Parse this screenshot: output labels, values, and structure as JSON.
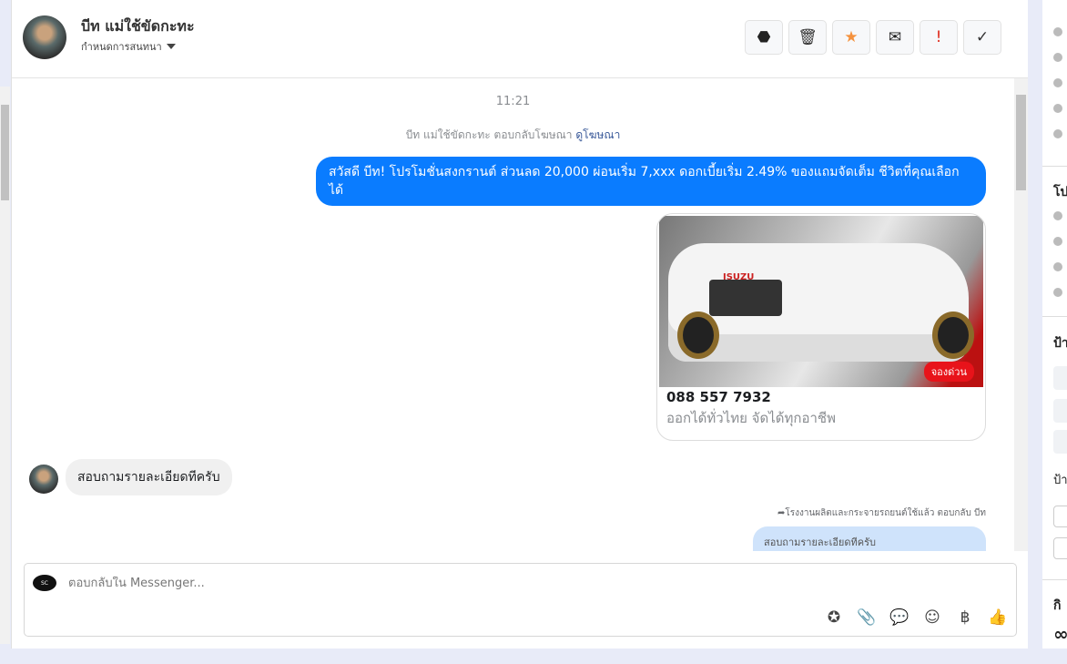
{
  "header": {
    "name": "บีท แม่ใช้ขัดกะทะ",
    "subtitle": "กำหนดการสนทนา"
  },
  "toolbar": [
    {
      "icon": "alert-octagon-icon",
      "glyph": "⬣",
      "color": "#222"
    },
    {
      "icon": "trash-icon",
      "glyph": "🗑",
      "color": "#333"
    },
    {
      "icon": "star-icon",
      "glyph": "★",
      "color": "#f5923e"
    },
    {
      "icon": "envelope-icon",
      "glyph": "✉",
      "color": "#222"
    },
    {
      "icon": "exclamation-icon",
      "glyph": "!",
      "color": "#e02a1b"
    },
    {
      "icon": "check-icon",
      "glyph": "✓",
      "color": "#333"
    }
  ],
  "chat": {
    "time": "11:21",
    "ad_note": "บีท แม่ใช้ขัดกะทะ ตอบกลับโฆษณา",
    "ad_link": "ดูโฆษณา",
    "outgoing_message": "สวัสดี บีท! โปรโมชั่นสงกรานต์ ส่วนลด 20,000 ผ่อนเริ่ม 7,xxx ดอกเบี้ยเริ่ม 2.49% ของแถมจัดเต็ม ชีวิตที่คุณเลือกได้",
    "card": {
      "brand": "ISUZU",
      "badge": "จองด่วน",
      "title": "088 557 7932",
      "description": "ออกได้ทั่วไทย จัดได้ทุกอาชีพ"
    },
    "incoming_message": "สอบถามรายละเอียดทีครับ",
    "reply_note": "โรงงานผลิตและกระจายรถยนต์ใช้แล้ว ตอบกลับ บีท",
    "reply_bubble": "สอบถามรายละเอียดทีครับ"
  },
  "composer": {
    "placeholder": "ตอบกลับใน Messenger...",
    "avatar_text": "SC"
  },
  "composer_icons": [
    {
      "icon": "saved-reply-icon",
      "glyph": "✪"
    },
    {
      "icon": "paperclip-icon",
      "glyph": "📎"
    },
    {
      "icon": "chat-bubble-icon",
      "glyph": "💬"
    },
    {
      "icon": "emoji-icon",
      "glyph": "☺"
    },
    {
      "icon": "baht-icon",
      "glyph": "฿"
    },
    {
      "icon": "thumbs-up-icon",
      "glyph": "👍"
    }
  ],
  "right_panel": {
    "section1": "โป",
    "section2": "ป้า",
    "section3": "ป้า",
    "section4": "กิ",
    "meta_symbol": "∞"
  }
}
